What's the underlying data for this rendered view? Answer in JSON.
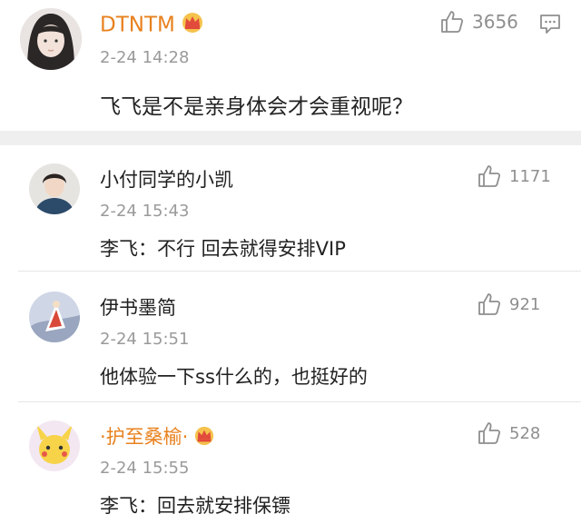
{
  "main_comment": {
    "username": "DTNTM",
    "timestamp": "2-24 14:28",
    "text": "飞飞是不是亲身体会才会重视呢？",
    "likes": "3656"
  },
  "replies": [
    {
      "username": "小付同学的小凯",
      "timestamp": "2-24 15:43",
      "text": "李飞：不行 回去就得安排VIP",
      "likes": "1171"
    },
    {
      "username": "伊书墨简",
      "timestamp": "2-24 15:51",
      "text": "他体验一下ss什么的，也挺好的",
      "likes": "921"
    },
    {
      "username": "·护至桑榆·",
      "timestamp": "2-24 15:55",
      "text": "李飞：回去就安排保镖",
      "likes": "528"
    }
  ],
  "colors": {
    "vip_name": "#e8811e",
    "muted": "#9a9a9a",
    "divider": "#efefef"
  },
  "icons": [
    "avatar",
    "vip-crown-icon",
    "thumbs-up-icon",
    "comment-reply-icon"
  ]
}
